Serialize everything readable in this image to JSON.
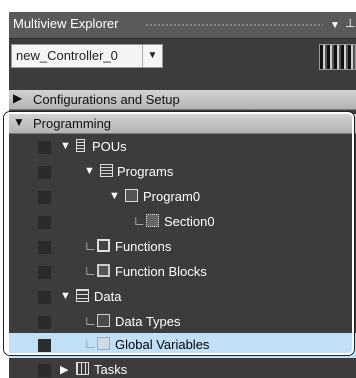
{
  "panel": {
    "title": "Multiview Explorer",
    "dropdown_icon": "chevron-down-icon",
    "pin_icon": "pin-icon"
  },
  "controller_select": {
    "value": "new_Controller_0",
    "arrow": "▼"
  },
  "sections": {
    "config": {
      "label": "Configurations and Setup",
      "expanded": false,
      "tri": "▶"
    },
    "programming": {
      "label": "Programming",
      "expanded": true,
      "tri": "▼"
    }
  },
  "tree": {
    "pous": {
      "label": "POUs",
      "tri": "▼",
      "icon": "pou-icon"
    },
    "programs": {
      "label": "Programs",
      "tri": "▼",
      "icon": "programs-folder-icon"
    },
    "program0": {
      "label": "Program0",
      "tri": "▼",
      "icon": "program-icon"
    },
    "section0": {
      "label": "Section0",
      "branch": "∟",
      "icon": "section-icon"
    },
    "functions": {
      "label": "Functions",
      "branch": "∟",
      "icon": "functions-icon"
    },
    "function_blocks": {
      "label": "Function Blocks",
      "branch": "∟",
      "icon": "function-blocks-icon"
    },
    "data": {
      "label": "Data",
      "tri": "▼",
      "icon": "data-icon"
    },
    "data_types": {
      "label": "Data Types",
      "branch": "∟",
      "icon": "data-types-icon"
    },
    "global_variables": {
      "label": "Global Variables",
      "branch": "∟",
      "icon": "global-variables-icon",
      "selected": true
    },
    "tasks": {
      "label": "Tasks",
      "tri": "▶",
      "icon": "tasks-icon"
    }
  },
  "colors": {
    "panel_bg": "#3c3c3c",
    "selected_bg": "#bfe0f7",
    "section_bg": "#c4c4c4"
  }
}
